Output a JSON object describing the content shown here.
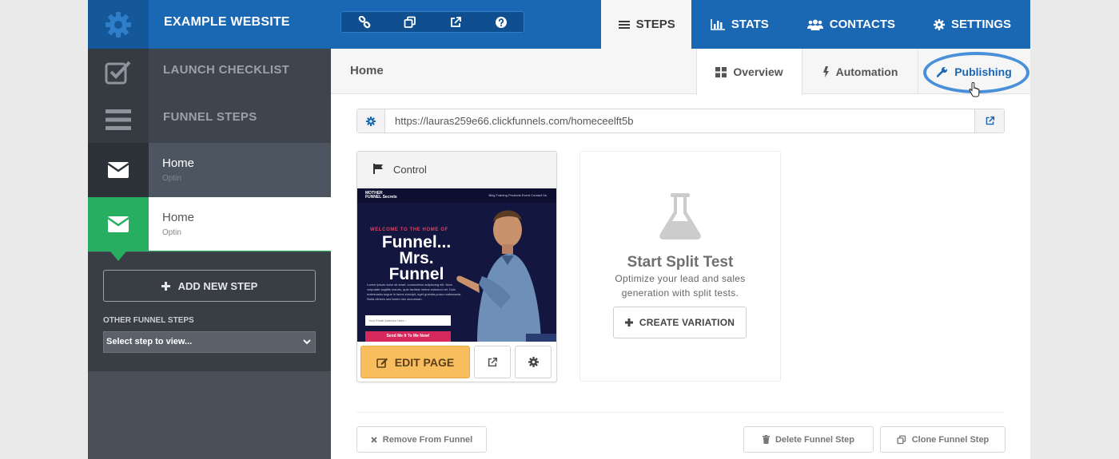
{
  "header": {
    "site_title": "EXAMPLE WEBSITE",
    "toolbar_icons": [
      "link-icon",
      "clone-icon",
      "external-link-icon",
      "help-icon"
    ],
    "nav": [
      {
        "label": "STEPS",
        "icon": "list-icon",
        "active": true
      },
      {
        "label": "STATS",
        "icon": "bar-chart-icon",
        "active": false
      },
      {
        "label": "CONTACTS",
        "icon": "users-icon",
        "active": false
      },
      {
        "label": "SETTINGS",
        "icon": "gear-icon",
        "active": false
      }
    ]
  },
  "sidebar": {
    "launch_checklist": "LAUNCH CHECKLIST",
    "funnel_steps": "FUNNEL STEPS",
    "steps": [
      {
        "title": "Home",
        "type": "Optin",
        "icon": "envelope-icon"
      },
      {
        "title": "Home",
        "type": "Optin",
        "icon": "envelope-icon",
        "selected": true
      }
    ],
    "add_new_step": "ADD NEW STEP",
    "other_funnel_steps": "OTHER FUNNEL STEPS",
    "step_select_value": "Select step to view..."
  },
  "main": {
    "page_name": "Home",
    "tabs": {
      "overview": "Overview",
      "automation": "Automation",
      "publishing": "Publishing"
    },
    "url": "https://lauras259e66.clickfunnels.com/homeceelft5b",
    "control_card": {
      "label": "Control",
      "preview": {
        "logo_line1": "MOTHER",
        "logo_line2": "FUNNEL Secrets",
        "nav_links": "Blog   Training   Products   Event   Contact Us",
        "kicker": "WELCOME TO THE HOME OF",
        "headline_1": "Funnel...",
        "headline_2": "Mrs.",
        "headline_3": "Funnel",
        "body": "Lorem ipsum dolor sit amet, consectetur adipiscing elit. Nam vulputate sagittis mauris, quis facilisis metus euismod vel. Duis malesuada augue in lacus suscipit, eget gravida purus malesuada. Nulla ultrices sed lorem nec accumsan.",
        "email_placeholder": "Your Email Address Here...",
        "cta": "Send Me It To Me Now!"
      },
      "edit_page": "EDIT PAGE"
    },
    "split_test": {
      "title": "Start Split Test",
      "description": "Optimize your lead and sales generation with split tests.",
      "create_variation": "CREATE VARIATION"
    },
    "footer": {
      "remove": "Remove From Funnel",
      "delete": "Delete Funnel Step",
      "clone": "Clone Funnel Step"
    }
  },
  "colors": {
    "brand_blue": "#1a67b3",
    "step_green": "#27ae60",
    "edit_orange": "#f8bd5c",
    "highlight_ring": "#4a90d9"
  }
}
